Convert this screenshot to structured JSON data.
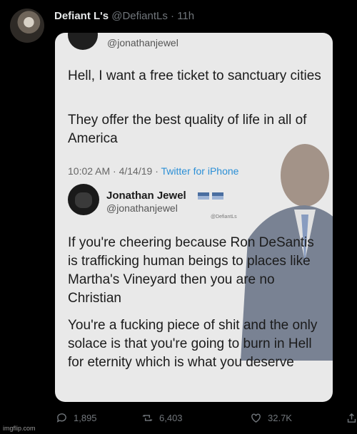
{
  "tweet": {
    "author_name": "Defiant L's",
    "author_handle": "@DefiantLs",
    "separator": "·",
    "time": "11h"
  },
  "quoted": {
    "top_handle": "@jonathanjewel",
    "paragraph1": "Hell, I want a free ticket to sanctuary cities",
    "paragraph2": "They offer the best quality of life in all of America",
    "timestamp": "10:02 AM · 4/14/19 ·",
    "source": "Twitter for iPhone",
    "nested": {
      "name": "Jonathan Jewel",
      "handle": "@jonathanjewel",
      "watermark": "@DefiantLs",
      "paragraph1": "If you're cheering because Ron DeSantis is trafficking human beings to places like Martha's Vineyard then you are no Christian",
      "paragraph2": "You're a fucking piece of shit and the only solace is that you're going to burn in Hell for eternity which is what you deserve"
    }
  },
  "actions": {
    "replies": "1,895",
    "retweets": "6,403",
    "likes": "32.7K"
  },
  "footer": {
    "imgflip": "imgflip.com"
  },
  "colors": {
    "background": "#000000",
    "card": "#e9e9e9",
    "link": "#2b8fd6",
    "muted": "#71767b"
  }
}
